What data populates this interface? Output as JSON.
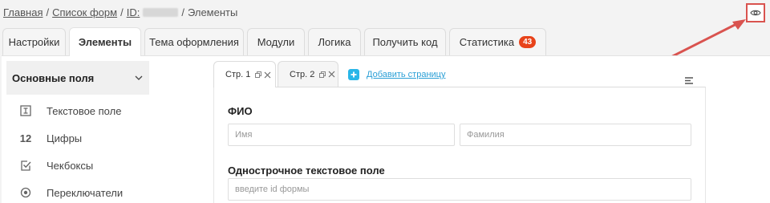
{
  "breadcrumb": {
    "home": "Главная",
    "forms_list": "Список форм",
    "id_label": "ID:",
    "current": "Элементы"
  },
  "preview_button": {
    "icon": "eye-icon"
  },
  "tabs": [
    {
      "label": "Настройки"
    },
    {
      "label": "Элементы",
      "active": true
    },
    {
      "label": "Тема оформления"
    },
    {
      "label": "Модули"
    },
    {
      "label": "Логика"
    },
    {
      "label": "Получить код"
    },
    {
      "label": "Статистика",
      "badge": "43"
    }
  ],
  "sidebar": {
    "header": "Основные поля",
    "items": [
      {
        "label": "Текстовое поле",
        "icon": "text-field-icon"
      },
      {
        "label": "Цифры",
        "icon": "numbers-icon",
        "icon_text": "12"
      },
      {
        "label": "Чекбоксы",
        "icon": "checkbox-icon"
      },
      {
        "label": "Переключатели",
        "icon": "radio-icon"
      }
    ]
  },
  "editor": {
    "pages": [
      {
        "label": "Стр. 1",
        "active": true
      },
      {
        "label": "Стр. 2"
      }
    ],
    "add_page": "Добавить страницу",
    "fields": [
      {
        "label": "ФИО",
        "placeholders": [
          "Имя",
          "Фамилия"
        ]
      },
      {
        "label": "Однострочное текстовое поле",
        "placeholders": [
          "введите id формы"
        ]
      }
    ]
  },
  "colors": {
    "accent": "#29b6e8",
    "badge": "#e8431a",
    "highlight": "#d9534f"
  }
}
